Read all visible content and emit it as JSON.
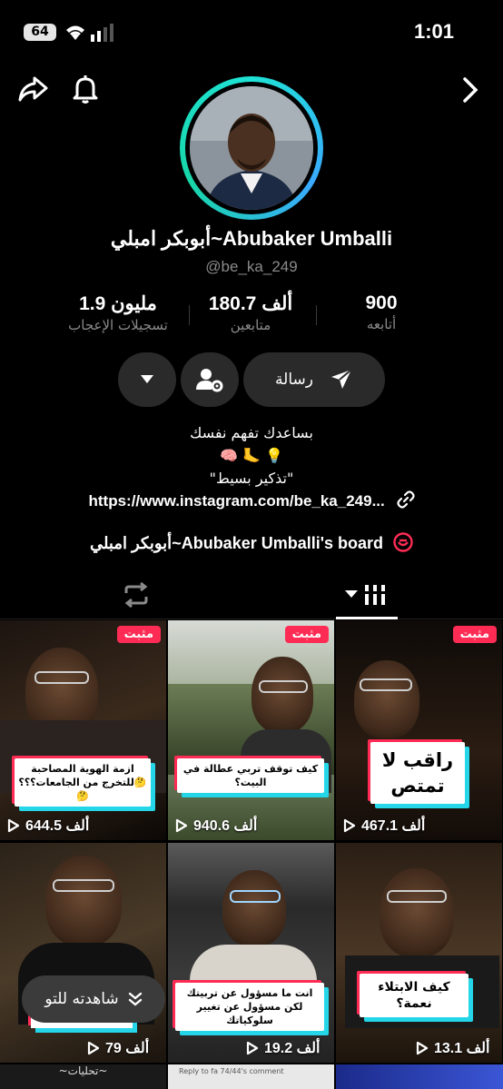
{
  "status": {
    "battery": "64",
    "time": "1:01"
  },
  "profile": {
    "display_name": "أبوبكر امبلي~Abubaker Umballi",
    "username": "@be_ka_249",
    "stats": [
      {
        "value": "900",
        "label": "أتابعه"
      },
      {
        "value": "180.7 ألف",
        "label": "متابعين"
      },
      {
        "value": "1.9 مليون",
        "label": "تسجيلات الإعجاب"
      }
    ],
    "message_label": "رسالة",
    "bio_lines": [
      "بساعدك تفهم نفسك",
      "🧠 🦶 💡",
      "\"تذكير بسيط\""
    ],
    "link": "https://www.instagram.com/be_ka_249...",
    "board": "أبوبكر امبلي~Abubaker Umballi's board"
  },
  "videos": [
    {
      "pinned": "مثبت",
      "views": "644.5 ألف",
      "caption": "ازمة الهوية المصاحبة للتخرج من الجامعات؟؟؟🤔🤔"
    },
    {
      "pinned": "مثبت",
      "views": "940.6 ألف",
      "caption": "كيف توقف تربي عطالة في البيت؟"
    },
    {
      "pinned": "مثبت",
      "views": "467.1 ألف",
      "caption": "راقب لا تمتص"
    },
    {
      "views": "79 ألف",
      "caption": ""
    },
    {
      "views": "19.2 ألف",
      "caption": "انت ما مسؤول عن تربيتك لكن مسؤول عن تغيير سلوكياتك"
    },
    {
      "views": "13.1 ألف",
      "caption": "كيف الابتلاء نعمة؟"
    }
  ],
  "watch_later": "شاهدته للتو",
  "bottom_strip": {
    "left_text": "~تحليات~",
    "mid_text": "Reply to fa 74/44's comment"
  },
  "colors": {
    "accent": "#fe2c55",
    "ring": "#1fe3d6",
    "cyan": "#24d6e8"
  }
}
